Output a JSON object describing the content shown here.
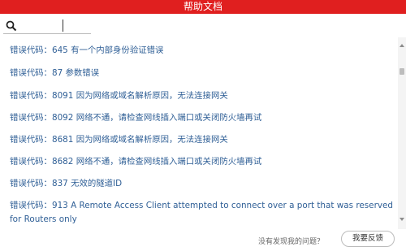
{
  "window": {
    "title": "帮助文档"
  },
  "search": {
    "value": ""
  },
  "errors": [
    "错误代码：645 有一个内部身份验证错误",
    "错误代码：87 参数错误",
    "错误代码：8091 因为网络或域名解析原因，无法连接网关",
    "错误代码：8092 网络不通，请检查网线插入端口或关闭防火墙再试",
    "错误代码：8681 因为网络或域名解析原因，无法连接网关",
    "错误代码：8682 网络不通，请检查网线插入端口或关闭防火墙再试",
    "错误代码：837 无效的隧道ID",
    "错误代码：913 A Remote Access Client attempted to connect over a port that was reserved for Routers only"
  ],
  "footer": {
    "question": "没有发现我的问题？",
    "feedback_label": "我要反馈"
  },
  "colors": {
    "title_bg": "#e01f1f",
    "link_text": "#2f5f96"
  },
  "icons": {
    "search": "search-icon"
  }
}
